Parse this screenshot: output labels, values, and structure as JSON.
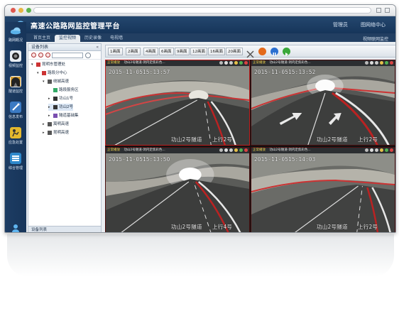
{
  "app": {
    "title": "高速公路路网监控管理平台",
    "header_links": [
      "管理员",
      "图网络中心"
    ],
    "subheader_right": "视频联网监控"
  },
  "colors": {
    "header": "#1b3c63",
    "selected_border": "#c21d1d",
    "osd_text": "#f0f0f0",
    "status_text": "#f2d34b"
  },
  "tabs": [
    {
      "label": "首页主页",
      "active": false
    },
    {
      "label": "监控视频",
      "active": true
    },
    {
      "label": "历史录像",
      "active": false
    },
    {
      "label": "电视墙",
      "active": false
    }
  ],
  "sidebar": {
    "items": [
      {
        "label": "路网概况",
        "icon": "cloud-icon"
      },
      {
        "label": "视频监控",
        "icon": "camera-icon"
      },
      {
        "label": "隧道监控",
        "icon": "tunnel-icon"
      },
      {
        "label": "信息发布",
        "icon": "broadcast-icon"
      },
      {
        "label": "应急处置",
        "icon": "emergency-icon"
      },
      {
        "label": "综合管理",
        "icon": "management-icon"
      }
    ],
    "user_icon": "user-icon"
  },
  "device_tree": {
    "header": "设备列表",
    "footer": "设备列表",
    "nodes": [
      {
        "label": "昆明东管理处",
        "level": 0
      },
      {
        "label": "路段分中心",
        "level": 1
      },
      {
        "label": "绕城高速",
        "level": 2
      },
      {
        "label": "路段服务区",
        "level": 3
      },
      {
        "label": "功山1号",
        "level": 2
      },
      {
        "label": "功山2号",
        "level": 2
      },
      {
        "label": "隧道基础集",
        "level": 2
      },
      {
        "label": "嵩明高速",
        "level": 1
      },
      {
        "label": "昆明高速",
        "level": 1
      }
    ]
  },
  "toolbar": {
    "layouts": [
      "1画面",
      "2画面",
      "4画面",
      "6画面",
      "9画面",
      "12画面",
      "16画面",
      "20画面"
    ],
    "controls": [
      {
        "name": "tools-icon",
        "color": "#555555"
      },
      {
        "name": "record-icon",
        "color": "#e36a1a"
      },
      {
        "name": "pause-icon",
        "color": "#2a6fd0"
      },
      {
        "name": "play-icon",
        "color": "#3aa83a"
      }
    ]
  },
  "video_cells": [
    {
      "status": "正常播放",
      "title": "功山2号隧道-洞内定焦彩色...",
      "date": "2015-11-05",
      "time": "15:13:57",
      "caption": "功山2号隧道",
      "direction": "上行2号",
      "selected": true
    },
    {
      "status": "正常播放",
      "title": "功山2号隧道-洞内定焦彩色...",
      "date": "2015-11-05",
      "time": "15:13:52",
      "caption": "功山2号隧道",
      "direction": "上行2号",
      "selected": false
    },
    {
      "status": "正常播放",
      "title": "功山2号隧道-洞内定焦彩色...",
      "date": "2015-11-05",
      "time": "15:13:50",
      "caption": "功山2号隧道",
      "direction": "上行4号",
      "selected": false
    },
    {
      "status": "正常播放",
      "title": "功山2号隧道-洞内定焦彩色...",
      "date": "2015-11-05",
      "time": "15:14:03",
      "caption": "功山2号隧道",
      "direction": "上行2号",
      "selected": false
    }
  ]
}
